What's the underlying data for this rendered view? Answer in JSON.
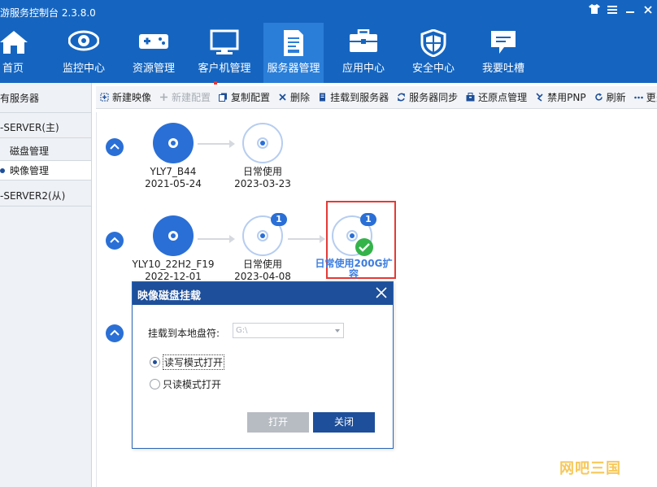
{
  "window": {
    "title": "游服务控制台 2.3.8.0",
    "controls": [
      "shirt-icon",
      "menu-icon",
      "minimize-icon",
      "close-icon"
    ]
  },
  "nav": {
    "items": [
      {
        "label": "首页",
        "icon": "home-icon",
        "active": false
      },
      {
        "label": "监控中心",
        "icon": "eye-icon",
        "active": false
      },
      {
        "label": "资源管理",
        "icon": "gamepad-icon",
        "active": false
      },
      {
        "label": "客户机管理",
        "icon": "monitor-icon",
        "active": false
      },
      {
        "label": "服务器管理",
        "icon": "server-doc-icon",
        "active": true
      },
      {
        "label": "应用中心",
        "icon": "toolbox-icon",
        "active": false
      },
      {
        "label": "安全中心",
        "icon": "shield-icon",
        "active": false
      },
      {
        "label": "我要吐槽",
        "icon": "chat-icon",
        "active": false
      }
    ]
  },
  "sidebar": {
    "items": [
      {
        "label": "有服务器",
        "sub": false,
        "selected": false
      },
      {
        "label": "-SERVER(主)",
        "sub": false,
        "selected": false
      },
      {
        "label": "磁盘管理",
        "sub": true,
        "selected": false
      },
      {
        "label": "映像管理",
        "sub": true,
        "selected": true
      },
      {
        "label": "-SERVER2(从)",
        "sub": false,
        "selected": false
      }
    ]
  },
  "toolbar": {
    "buttons": [
      {
        "label": "新建映像",
        "icon": "new-image-icon",
        "enabled": true
      },
      {
        "label": "新建配置",
        "icon": "plus-icon",
        "enabled": false
      },
      {
        "label": "复制配置",
        "icon": "copy-icon",
        "enabled": true
      },
      {
        "label": "删除",
        "icon": "delete-icon",
        "enabled": true
      },
      {
        "label": "挂载到服务器",
        "icon": "mount-icon",
        "enabled": true
      },
      {
        "label": "服务器同步",
        "icon": "sync-icon",
        "enabled": true
      },
      {
        "label": "还原点管理",
        "icon": "restore-icon",
        "enabled": true
      },
      {
        "label": "禁用PNP",
        "icon": "pnp-icon",
        "enabled": true
      },
      {
        "label": "刷新",
        "icon": "refresh-icon",
        "enabled": true
      },
      {
        "label": "更多",
        "icon": "more-icon",
        "enabled": true
      }
    ]
  },
  "images": [
    {
      "nodes": [
        {
          "name": "YLY7_B44",
          "date": "2021-05-24",
          "type": "base"
        },
        {
          "name": "日常使用",
          "date": "2023-03-23",
          "type": "config"
        }
      ]
    },
    {
      "nodes": [
        {
          "name": "YLY10_22H2_F19",
          "date": "2022-12-01",
          "type": "base"
        },
        {
          "name": "日常使用",
          "date": "2023-04-08",
          "type": "config",
          "badge": "1"
        },
        {
          "name": "日常使用200G扩容",
          "date": "",
          "type": "config",
          "badge": "1",
          "selected": true
        }
      ]
    }
  ],
  "dialog": {
    "title": "映像磁盘挂载",
    "drive_label": "挂载到本地盘符:",
    "drive_value": "G:\\",
    "radio_rw": "读写模式打开",
    "radio_ro": "只读模式打开",
    "selected_mode": "rw",
    "open_button": "打开",
    "close_button": "关闭"
  },
  "watermark": "网吧三国"
}
